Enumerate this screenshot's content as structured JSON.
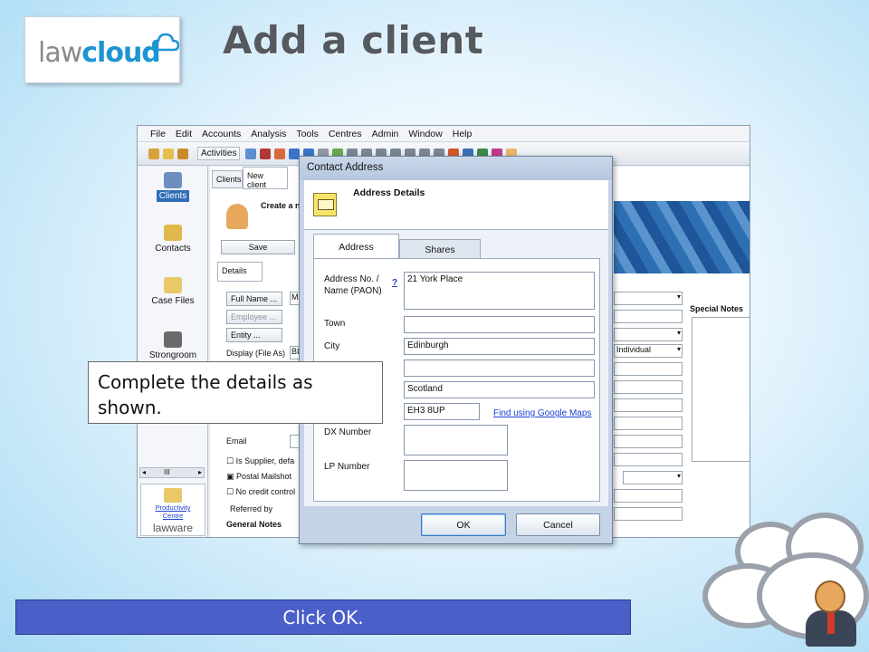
{
  "logo": {
    "part1": "law",
    "part2": "cloud"
  },
  "slide_title": "Add a client",
  "app": {
    "menu": [
      "File",
      "Edit",
      "Accounts",
      "Analysis",
      "Tools",
      "Centres",
      "Admin",
      "Window",
      "Help"
    ],
    "toolbar_activities": "Activities",
    "sidebar": [
      {
        "label": "Clients",
        "icon": "clients-icon"
      },
      {
        "label": "Contacts",
        "icon": "contacts-icon"
      },
      {
        "label": "Case Files",
        "icon": "case-files-icon"
      },
      {
        "label": "Strongroom",
        "icon": "strongroom-icon"
      }
    ],
    "sidebar_scroll": "III",
    "productivity_label": "Productivity Centre",
    "lawware_label": "lawware",
    "tabs": {
      "clients": "Clients",
      "new_client": "New client"
    },
    "create_label": "Create a n",
    "save_button": "Save",
    "details_tab": "Details",
    "full_name_btn": "Full Name ...",
    "full_name_value": "Mr",
    "employee_btn": "Employee ...",
    "entity_btn": "Entity ...",
    "display_label": "Display (File As)",
    "display_value": "BL",
    "email_label": "Email",
    "is_supplier": "Is Supplier, defa",
    "postal_mailshot": "Postal Mailshot",
    "no_credit": "No credit control",
    "referred_by": "Referred by",
    "general_notes": "General Notes",
    "entity_type_value": "Individual",
    "special_notes": "Special Notes"
  },
  "dialog": {
    "title": "Contact Address",
    "header_title": "Address Details",
    "tab_address": "Address",
    "tab_shares": "Shares",
    "address_label": "Address No. / Name (PAON)",
    "help_link": "?",
    "address_value": "21 York Place",
    "town_label": "Town",
    "town_value": "",
    "city_label": "City",
    "city_value": "Edinburgh",
    "county_value": "",
    "country_value": "Scotland",
    "postcode_value": "EH3 8UP",
    "find_maps_link": "Find using Google Maps",
    "dx_label": "DX Number",
    "dx_value": "",
    "lp_label": "LP Number",
    "lp_value": "",
    "ok_button": "OK",
    "cancel_button": "Cancel"
  },
  "callout_text": "Complete the details as shown.",
  "instruction_text": "Click OK.",
  "colors": {
    "accent": "#1c95d3",
    "instruction_bar": "#4a5fc8",
    "selected_nav": "#2f6db5"
  }
}
